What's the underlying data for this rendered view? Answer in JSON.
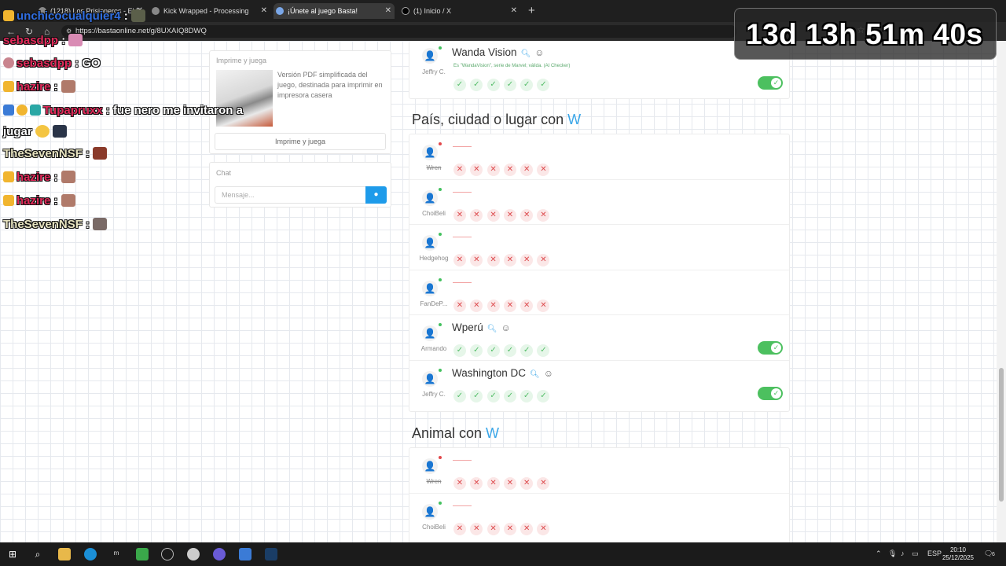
{
  "browser": {
    "tabs": [
      {
        "title": "(1218) Los Prisioneros - El Ba",
        "active": false
      },
      {
        "title": "Kick Wrapped - Processing",
        "active": false
      },
      {
        "title": "¡Únete al juego Basta!",
        "active": true
      },
      {
        "title": "(1) Inicio / X",
        "active": false
      }
    ],
    "new_tab": "+",
    "url": "https://bastaonline.net/g/8UXAIQ8DWQ"
  },
  "sidebar": {
    "print": {
      "title": "Imprime y juega",
      "description": "Versión PDF simplificada del juego, destinada para imprimir en impresora casera",
      "button": "Imprime y juega"
    },
    "chat": {
      "title": "Chat",
      "placeholder": "Mensaje..."
    }
  },
  "sections": {
    "prev": {
      "rows": [
        {
          "answer": "Wanda Vision",
          "player": "Jeffry C.",
          "note": "Es \"WandaVision\", serie de Marvel; válida. (AI Checker)",
          "marks": [
            "ok",
            "ok",
            "ok",
            "ok",
            "ok",
            "ok"
          ],
          "valid": true
        }
      ]
    },
    "place": {
      "title": "País, ciudad o lugar con ",
      "letter": "W",
      "rows": [
        {
          "answer": "",
          "player": "Wren",
          "marks": [
            "bad",
            "bad",
            "bad",
            "bad",
            "bad",
            "bad"
          ],
          "valid": false
        },
        {
          "answer": "",
          "player": "ChoiBeli",
          "marks": [
            "bad",
            "bad",
            "bad",
            "bad",
            "bad",
            "bad"
          ],
          "valid": false
        },
        {
          "answer": "",
          "player": "Hedgehog",
          "marks": [
            "bad",
            "bad",
            "bad",
            "bad",
            "bad",
            "bad"
          ],
          "valid": false
        },
        {
          "answer": "",
          "player": "FanDeP...",
          "marks": [
            "bad",
            "bad",
            "bad",
            "bad",
            "bad",
            "bad"
          ],
          "valid": false
        },
        {
          "answer": "Wperú",
          "player": "Armando",
          "marks": [
            "ok",
            "ok",
            "ok",
            "ok",
            "ok",
            "ok"
          ],
          "valid": true
        },
        {
          "answer": "Washington DC",
          "player": "Jeffry C.",
          "marks": [
            "ok",
            "ok",
            "ok",
            "ok",
            "ok",
            "ok"
          ],
          "valid": true
        }
      ]
    },
    "animal": {
      "title": "Animal con ",
      "letter": "W",
      "rows": [
        {
          "answer": "",
          "player": "Wren",
          "marks": [
            "bad",
            "bad",
            "bad",
            "bad",
            "bad",
            "bad"
          ],
          "valid": false
        },
        {
          "answer": "",
          "player": "ChoiBeli",
          "marks": [
            "bad",
            "bad",
            "bad",
            "bad",
            "bad",
            "bad"
          ],
          "valid": false
        }
      ]
    }
  },
  "overlay": {
    "timer": "13d 13h 51m 40s",
    "chat": [
      {
        "user": "unchicocualquier4",
        "message": ":"
      },
      {
        "user": "sebasdpp",
        "message": ":"
      },
      {
        "user": "sebasdpp",
        "message": ": GO"
      },
      {
        "user": "hazire",
        "message": ":"
      },
      {
        "user": "Tupapruxx",
        "message": ": fue nero me invitaron a"
      },
      {
        "user": "",
        "message": "jugar"
      },
      {
        "user": "TheSevenNSF",
        "message": ":"
      },
      {
        "user": "hazire",
        "message": ":"
      },
      {
        "user": "hazire",
        "message": ":"
      },
      {
        "user": "TheSevenNSF",
        "message": ":"
      }
    ]
  },
  "taskbar": {
    "lang": "ESP",
    "time": "20:10",
    "date": "25/12/2025",
    "notifications": "6"
  },
  "colors": {
    "accent": "#3aa6e8",
    "valid": "#4cc05f",
    "invalid": "#dd4b4e",
    "chat_user": "#e3295a"
  }
}
